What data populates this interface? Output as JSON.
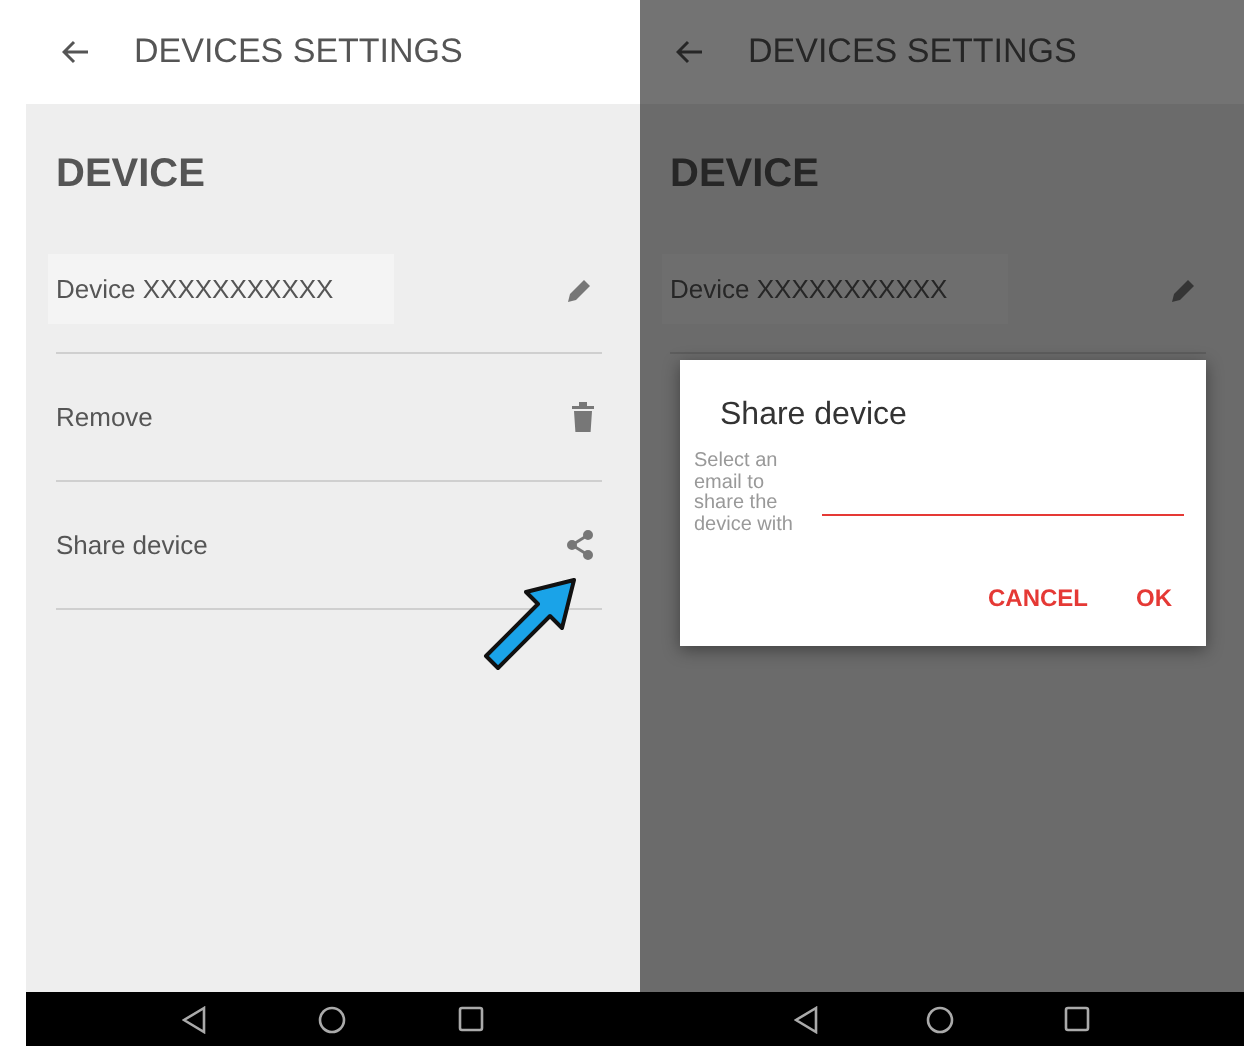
{
  "screens": [
    {
      "title": "DEVICES SETTINGS",
      "section": "DEVICE",
      "dimmed": false,
      "rows": [
        {
          "kind": "name",
          "label": "Device XXXXXXXXXXX",
          "pointed": false
        },
        {
          "kind": "remove",
          "label": "Remove",
          "pointed": false
        },
        {
          "kind": "share",
          "label": "Share device",
          "pointed": true
        }
      ]
    },
    {
      "title": "DEVICES SETTINGS",
      "section": "DEVICE",
      "dimmed": true,
      "rows": [
        {
          "kind": "name",
          "label": "Device XXXXXXXXXXX",
          "pointed": false
        }
      ],
      "dialog": {
        "title": "Share device",
        "field_label": "Select an email to share the device with",
        "buttons": [
          "CANCEL",
          "OK"
        ]
      }
    }
  ]
}
